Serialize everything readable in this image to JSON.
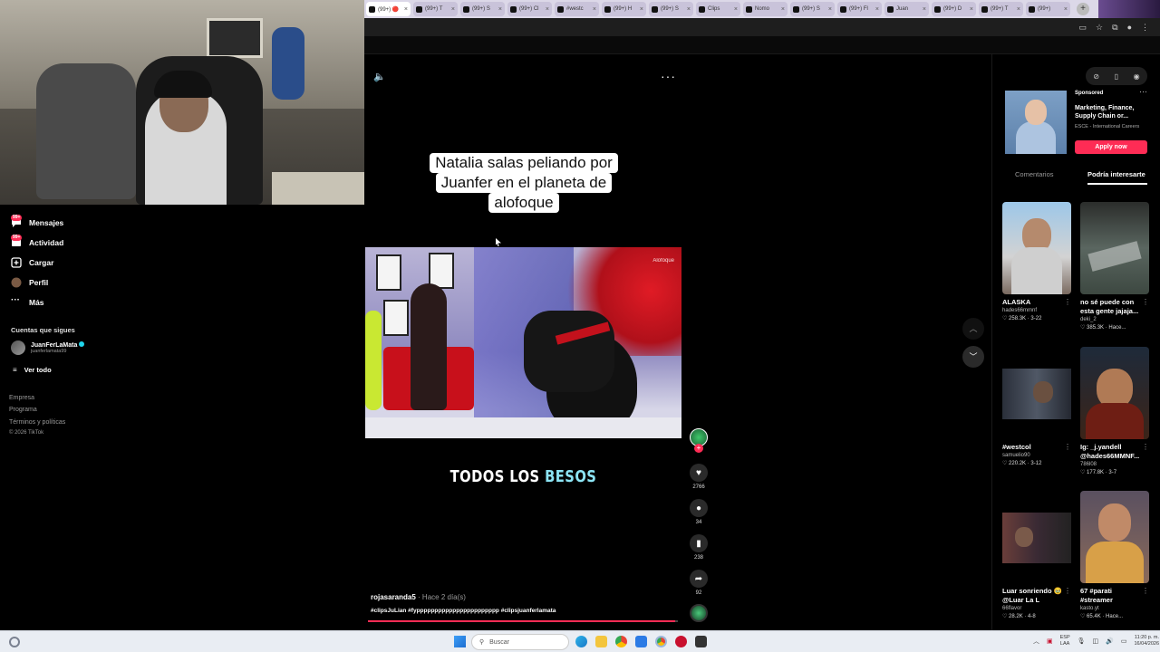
{
  "browser": {
    "tabs": [
      {
        "label": "(99+) 🔴"
      },
      {
        "label": "(99+) T"
      },
      {
        "label": "(99+) S"
      },
      {
        "label": "(99+) Cl"
      },
      {
        "label": "#westc"
      },
      {
        "label": "(99+) H"
      },
      {
        "label": "(99+) S"
      },
      {
        "label": "Clips"
      },
      {
        "label": "Nomo"
      },
      {
        "label": "(99+) S"
      },
      {
        "label": "(99+) Fl"
      },
      {
        "label": "Juan"
      },
      {
        "label": "(99+) D"
      },
      {
        "label": "(99+) T"
      },
      {
        "label": "(99+) "
      }
    ],
    "new_tab_label": "+"
  },
  "sidebar": {
    "items": [
      {
        "label": "Mensajes",
        "badge": "99+",
        "icon": "message-icon"
      },
      {
        "label": "Actividad",
        "badge": "99+",
        "icon": "inbox-icon"
      },
      {
        "label": "Cargar",
        "icon": "upload-icon"
      },
      {
        "label": "Perfil",
        "icon": "profile-icon"
      },
      {
        "label": "Más",
        "icon": "more-icon"
      }
    ],
    "following_title": "Cuentas que sigues",
    "following": [
      {
        "name": "JuanFerLaMata",
        "handle": "juanferlamata99"
      }
    ],
    "see_all": "Ver todo",
    "footer": [
      "Empresa",
      "Programa",
      "Términos y políticas",
      "© 2026 TikTok"
    ]
  },
  "video": {
    "caption_lines": [
      "Natalia salas peliando por",
      "Juanfer en el planeta de",
      "alofoque"
    ],
    "subtitle_prefix": "TODOS LOS ",
    "subtitle_highlight": "BESOS",
    "watermark": "Alofoque",
    "author": "rojasaranda5",
    "date": " · Hace 2 día(s)",
    "hashtags": "#clipsJuLian #fyppppppppppppppppppppppp #clipsjuanferlamata",
    "progress": 0.99,
    "actions": {
      "likes": "2766",
      "comments": "34",
      "saves": "238",
      "shares": "92"
    }
  },
  "right_panel": {
    "ad": {
      "sponsored": "Sponsored",
      "title": "Marketing, Finance, Supply Chain or...",
      "source": "ESCE - International Careers",
      "cta": "Apply now"
    },
    "tabs": [
      {
        "label": "Comentarios"
      },
      {
        "label": "Podría interesarte"
      }
    ],
    "cards": [
      {
        "title": "ALASKA",
        "author": "hades66mmnf",
        "meta": "♡ 258.3K · 3-22"
      },
      {
        "title": "no sé puede con esta gente jajaja...",
        "author": "deki_2",
        "meta": "♡ 385.3K · Hace..."
      },
      {
        "title": "#westcol",
        "author": "samuelio90",
        "meta": "♡ 220.2K · 3-12"
      },
      {
        "title": "Ig: _j.yandell @hades66MMNF...",
        "author": "786l08",
        "meta": "♡ 177.8K · 3-7"
      },
      {
        "title": "Luar sonriendo 🥹 @Luar La L @Lua...",
        "author": "66flavor",
        "meta": "♡ 28.2K · 4-8"
      },
      {
        "title": "67 #parati #streamer",
        "author": "kasto.yt",
        "meta": "♡ 65.4K · Hace..."
      }
    ]
  },
  "taskbar": {
    "search_placeholder": "Buscar",
    "lang": [
      "ESP",
      "LAA"
    ],
    "time": "11:20 p. m.",
    "date": "16/04/2026"
  },
  "colors": {
    "accent": "#fe2c55",
    "subtitle_highlight": "#8ce4f4",
    "background": "#000000"
  }
}
